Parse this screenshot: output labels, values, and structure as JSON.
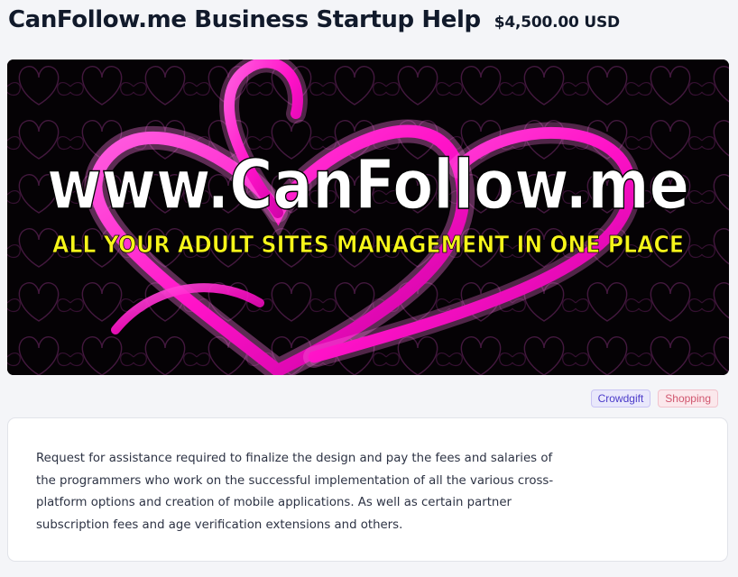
{
  "header": {
    "title": "CanFollow.me Business Startup Help",
    "price": "$4,500.00 USD"
  },
  "banner": {
    "headline": "www.CanFollow.me",
    "tagline": "ALL YOUR ADULT SITES MANAGEMENT IN ONE PLACE",
    "colors": {
      "background": "#050205",
      "heart": "#ff1fcf",
      "heart_glow": "#ff7ae6",
      "headline": "#ffffff",
      "tagline": "#f6f51a"
    }
  },
  "tags": [
    {
      "label": "Crowdgift",
      "color": "#4b3bc9"
    },
    {
      "label": "Shopping",
      "color": "#d0566e"
    }
  ],
  "description": "Request for assistance required to finalize the design and pay the fees and salaries of the programmers who work on the successful implementation of all the various cross-platform options and creation of mobile applications. As well as certain partner subscription fees and age verification extensions and others."
}
